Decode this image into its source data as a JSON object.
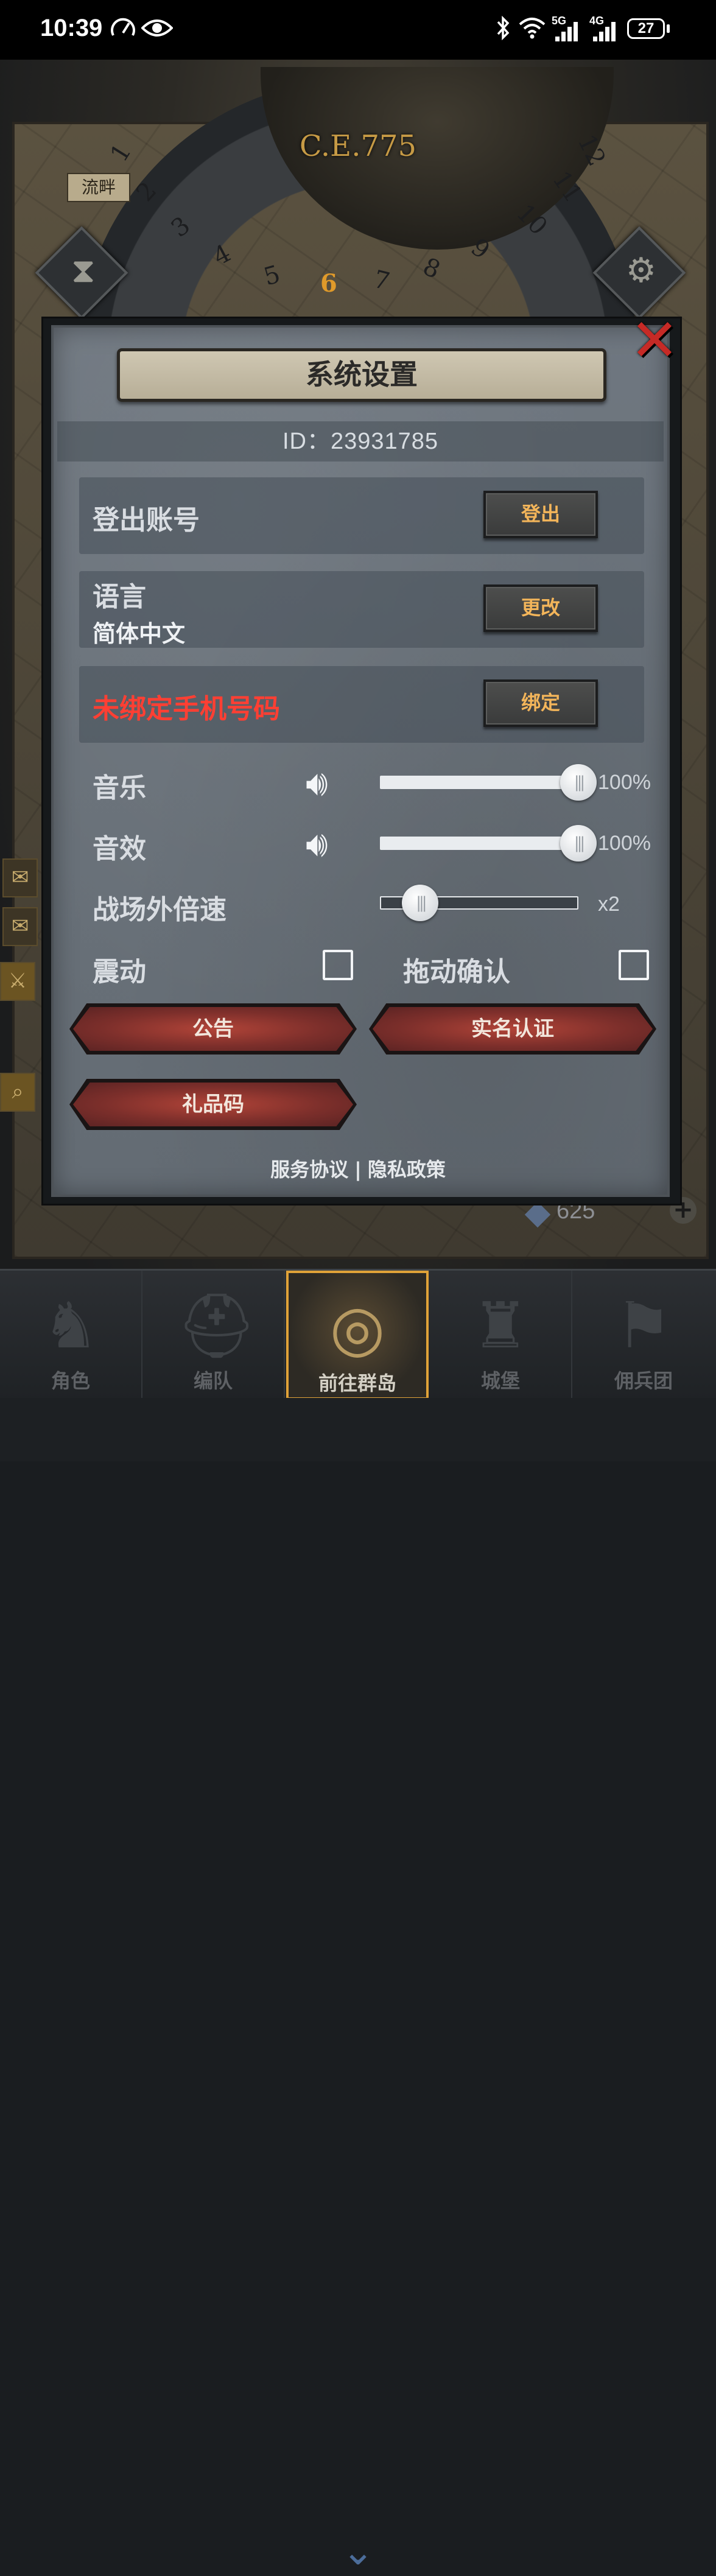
{
  "status_bar": {
    "time": "10:39",
    "icons": [
      "speedometer-icon",
      "eye-icon",
      "bluetooth-icon",
      "wifi-icon",
      "signal-5g-icon",
      "signal-4g-icon"
    ],
    "signal_5g": "5G",
    "signal_4g": "4G",
    "battery": "27"
  },
  "game": {
    "year": "C.E.775",
    "dial_numbers": [
      "1",
      "2",
      "3",
      "4",
      "5",
      "6",
      "7",
      "8",
      "9",
      "10",
      "11",
      "12"
    ],
    "active_number": "6",
    "town_label": "流畔",
    "resource_value": "625"
  },
  "modal": {
    "title": "系统设置",
    "id_text": "ID：23931785",
    "logout": {
      "label": "登出账号",
      "button": "登出"
    },
    "language": {
      "label": "语言",
      "value": "简体中文",
      "button": "更改"
    },
    "phone": {
      "label": "未绑定手机号码",
      "button": "绑定",
      "warn_color": "#ff3f33"
    },
    "music": {
      "label": "音乐",
      "value": 100,
      "display": "100%"
    },
    "sound": {
      "label": "音效",
      "value": 100,
      "display": "100%"
    },
    "speed": {
      "label": "战场外倍速",
      "value": 0.2,
      "display": "x2"
    },
    "vibrate": {
      "label": "震动",
      "checked": false
    },
    "drag_confirm": {
      "label": "拖动确认",
      "checked": false
    },
    "buttons": {
      "notice": "公告",
      "realname": "实名认证",
      "gift": "礼品码"
    },
    "footer": {
      "tos": "服务协议",
      "separator": "|",
      "privacy": "隐私政策"
    },
    "close_icon": "close-x-icon"
  },
  "bottom_nav": [
    {
      "label": "角色",
      "icon": "knight-icon",
      "active": false
    },
    {
      "label": "编队",
      "icon": "helmet-icon",
      "active": false
    },
    {
      "label": "前往群岛",
      "icon": "globe-icon",
      "active": true
    },
    {
      "label": "城堡",
      "icon": "castle-icon",
      "active": false
    },
    {
      "label": "佣兵团",
      "icon": "banner-icon",
      "active": false
    }
  ],
  "colors": {
    "accent": "#e0a238",
    "button_text": "#f3b55a",
    "warn": "#ff3f33"
  }
}
